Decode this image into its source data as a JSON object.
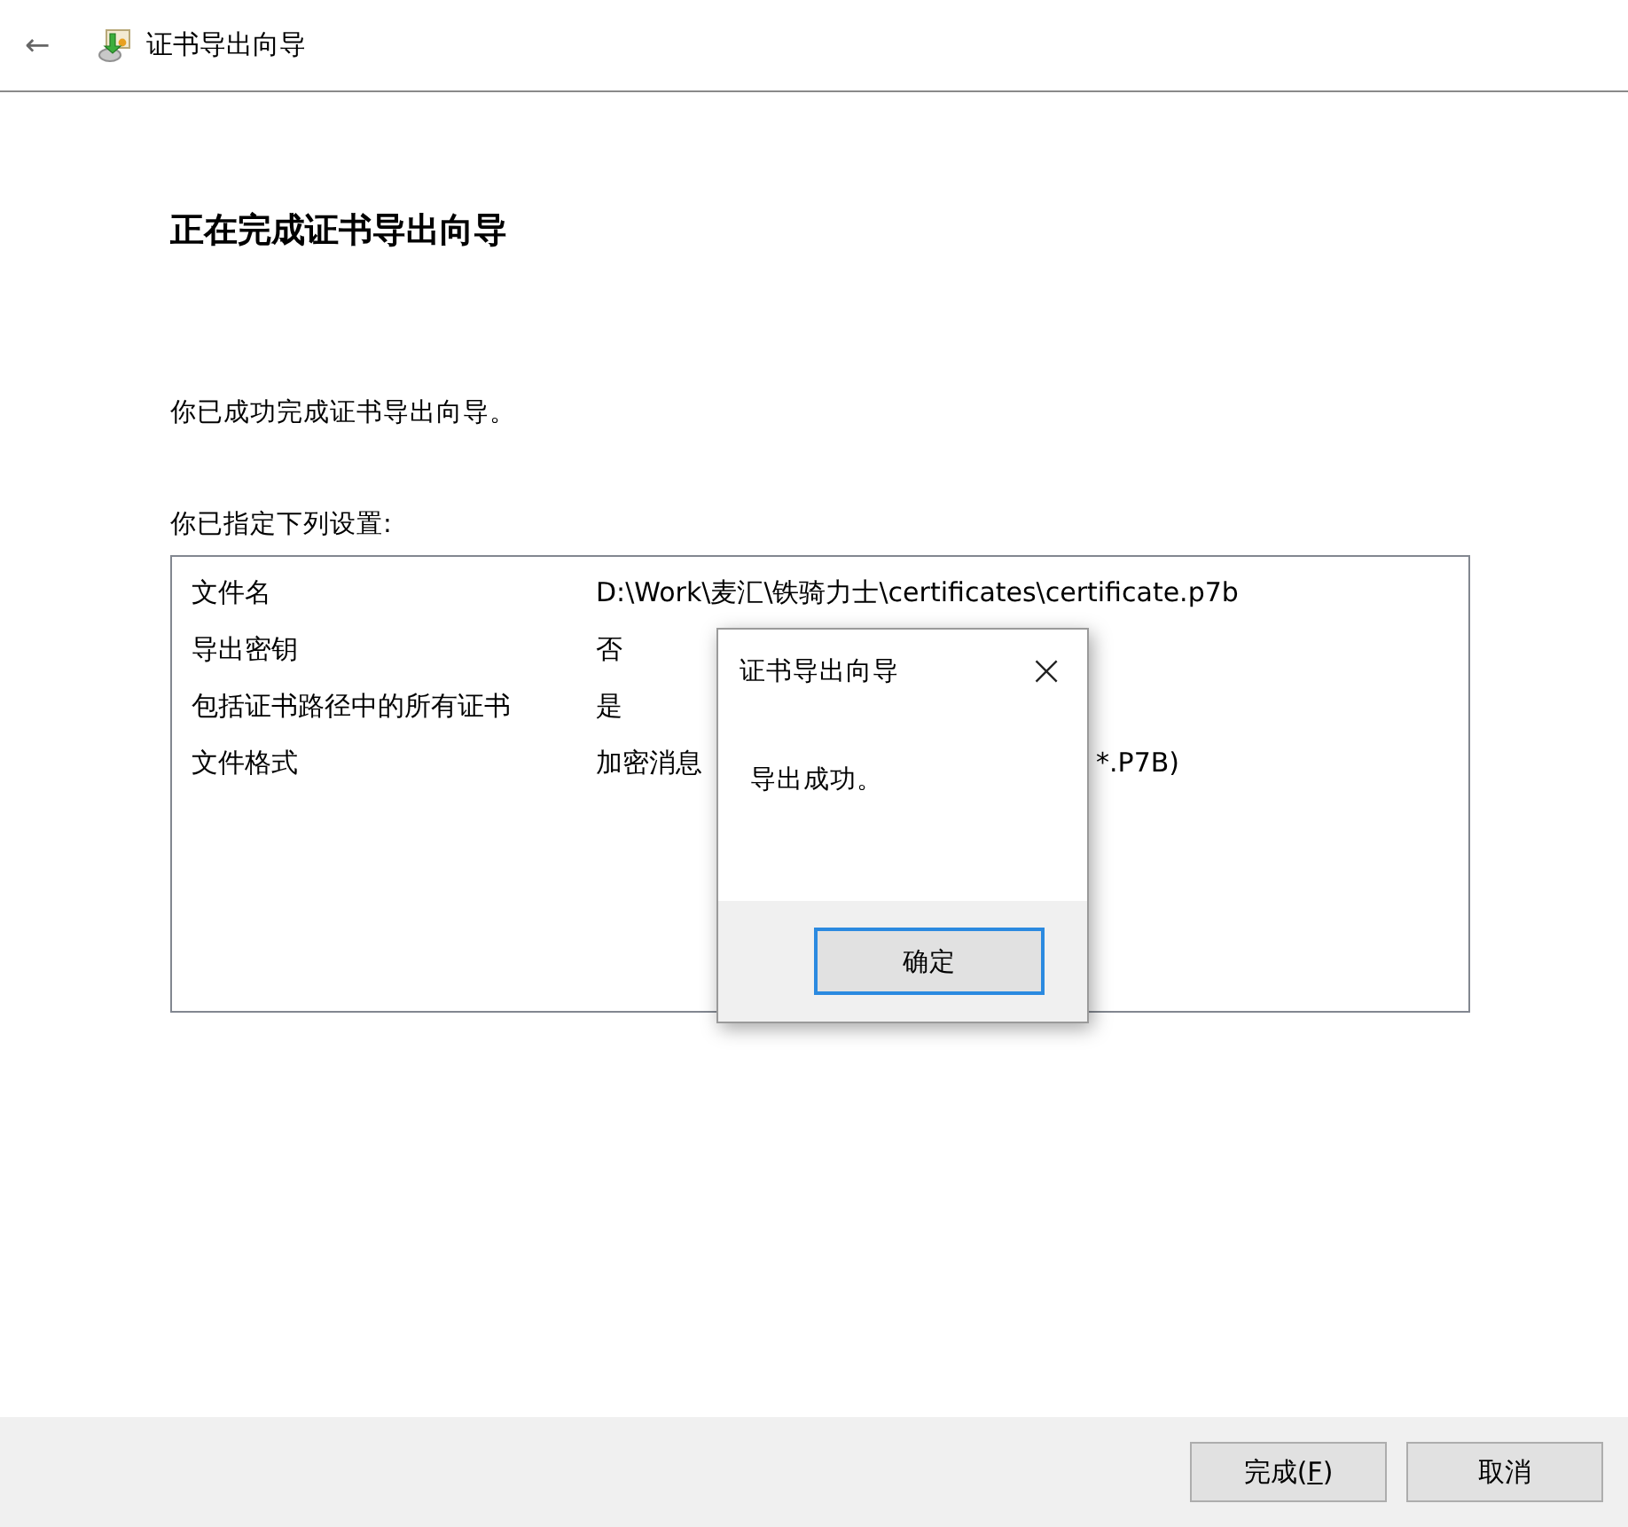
{
  "window": {
    "title": "证书导出向导",
    "back": "←"
  },
  "heading": "正在完成证书导出向导",
  "intro": "你已成功完成证书导出向导。",
  "settings_label": "你已指定下列设置:",
  "settings": [
    {
      "name": "文件名",
      "value": [
        "D:\\Work\\麦汇\\铁骑力士\\certificates\\certificate.p7b"
      ]
    },
    {
      "name": "导出密钥",
      "value": [
        "否"
      ]
    },
    {
      "name": "包括证书路径中的所有证书",
      "value": [
        "是"
      ]
    },
    {
      "name": "文件格式",
      "value": [
        "加密消息",
        "*.P7B)"
      ]
    }
  ],
  "dialog": {
    "title": "证书导出向导",
    "close": "×",
    "message": "导出成功。",
    "button": "确定"
  },
  "buttons": [
    {
      "kind": "accelerator",
      "label": [
        "完成(",
        "F",
        ")"
      ]
    },
    {
      "kind": "plain",
      "label": [
        "取消"
      ]
    }
  ]
}
